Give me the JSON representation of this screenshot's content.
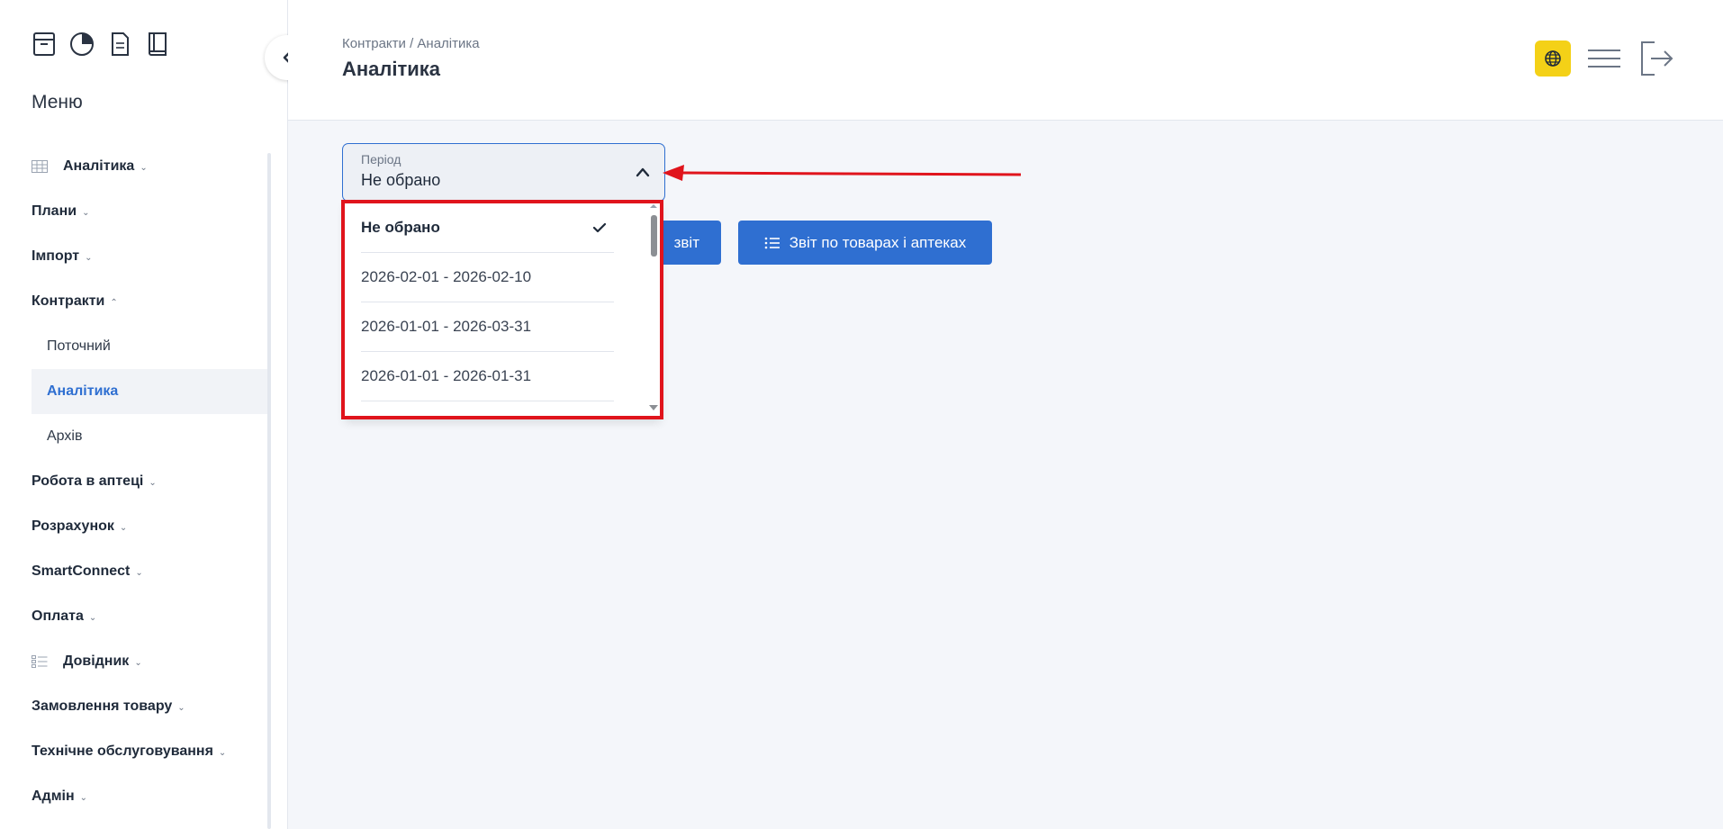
{
  "sidebar": {
    "menu_title": "Меню",
    "top_icons": [
      "archive-icon",
      "pie-chart-icon",
      "document-icon",
      "book-icon"
    ],
    "items": [
      {
        "label": "Аналітика",
        "icon": "table-icon",
        "expanded": false
      },
      {
        "label": "Плани",
        "expanded": false
      },
      {
        "label": "Імпорт",
        "expanded": false
      },
      {
        "label": "Контракти",
        "expanded": true
      },
      {
        "label": "Поточний",
        "sub": true
      },
      {
        "label": "Аналітика",
        "sub": true,
        "active": true
      },
      {
        "label": "Архів",
        "sub": true
      },
      {
        "label": "Робота в аптеці",
        "expanded": false
      },
      {
        "label": "Розрахунок",
        "expanded": false
      },
      {
        "label": "SmartConnect",
        "expanded": false
      },
      {
        "label": "Оплата",
        "expanded": false
      },
      {
        "label": "Довідник",
        "icon": "list-icon",
        "expanded": false
      },
      {
        "label": "Замовлення товару",
        "expanded": false
      },
      {
        "label": "Технічне обслуговування",
        "expanded": false
      },
      {
        "label": "Адмін",
        "expanded": false
      }
    ]
  },
  "header": {
    "breadcrumb": "Контракти / Аналітика",
    "title": "Аналітика"
  },
  "period_select": {
    "label": "Період",
    "value": "Не обрано",
    "options": [
      {
        "label": "Не обрано",
        "selected": true
      },
      {
        "label": "2026-02-01 - 2026-02-10",
        "selected": false
      },
      {
        "label": "2026-01-01 - 2026-03-31",
        "selected": false
      },
      {
        "label": "2026-01-01 - 2026-01-31",
        "selected": false
      }
    ]
  },
  "buttons": {
    "report_label": "звіт",
    "products_report_label": "Звіт по товарах і аптеках"
  },
  "colors": {
    "accent": "#2f6fd1",
    "highlight": "#e0141c",
    "globe_button": "#f4d117"
  }
}
